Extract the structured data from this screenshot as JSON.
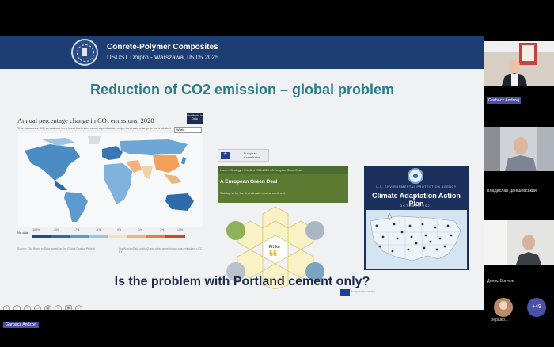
{
  "slide": {
    "header": {
      "title": "Conrete-Polymer Composites",
      "subtitle": "USUST Dnipro - Warszawa, 05.05.2025"
    },
    "title": "Reduction of CO2 emission – global problem",
    "chart": {
      "title": "Annual percentage change in CO₂ emissions, 2020",
      "desc": "This measures CO₂ emissions from fossil fuels and cement production only – land use change is not included.",
      "source_badge": "Our World in Data",
      "region_select": "World",
      "legend_label": "No data",
      "legend_ticks": [
        "-100%",
        "-10%",
        "-7%",
        "-1%",
        "0%",
        "1%",
        "7%",
        "10%"
      ],
      "source": "Source: Our World in Data based on the Global Carbon Project",
      "link": "OurWorldInData.org/co2-and-other-greenhouse-gas-emissions • CC BY"
    },
    "eu": {
      "logo_text": "European Commission",
      "breadcrumb": "Home > Strategy > Priorities 2019-2024 > A European Green Deal",
      "title": "A European Green Deal",
      "subtitle": "Striving to be the first climate-neutral continent",
      "fit_label": "Fit for",
      "fit_number": "55",
      "flag_caption": "European Commission"
    },
    "epa": {
      "agency": "U.S. ENVIRONMENTAL PROTECTION AGENCY",
      "title": "Climate Adaptation Action Plan",
      "date": "OCTOBER 2021"
    },
    "question": "Is the problem with Portland cement only?"
  },
  "participants": [
    {
      "name": "Garbacz Andrzej"
    },
    {
      "name": "Владислав Данішевський"
    },
    {
      "name": "Денис Волчок"
    },
    {
      "name": "Вершко..."
    }
  ],
  "more_participants": "+49",
  "presenter_tag": "Garbacz Andrzej",
  "colors": {
    "header_bg": "#1d3e72",
    "title": "#2b7d8d",
    "accent": "#4b51a6"
  }
}
